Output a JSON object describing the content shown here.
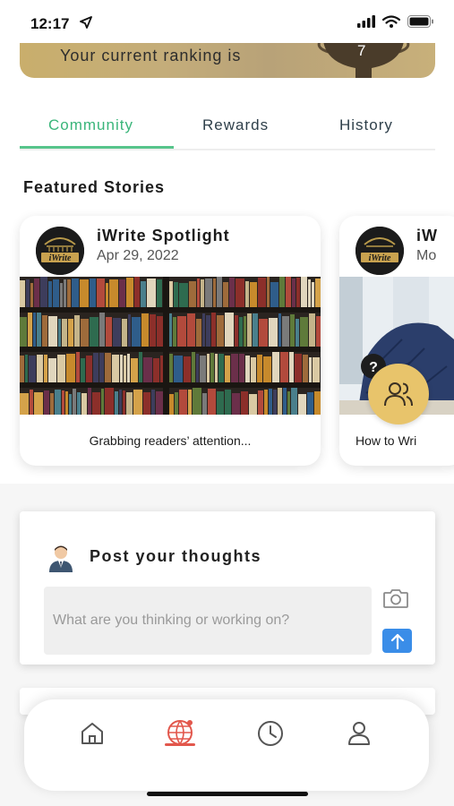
{
  "status_bar": {
    "time": "12:17"
  },
  "ranking": {
    "label": "Your current ranking is",
    "value": "7"
  },
  "tabs": [
    {
      "label": "Community",
      "active": true
    },
    {
      "label": "Rewards",
      "active": false
    },
    {
      "label": "History",
      "active": false
    }
  ],
  "featured": {
    "title": "Featured Stories",
    "stories": [
      {
        "author": "iWrite Spotlight",
        "date": "Apr 29, 2022",
        "caption": "Grabbing readers’ attention..."
      },
      {
        "author": "iW",
        "date": "Mo",
        "caption": "How to Wri"
      }
    ],
    "logo_text": "iWrite"
  },
  "post": {
    "title": "Post your thoughts",
    "placeholder": "What are you thinking or working on?"
  },
  "help_badge": "?",
  "colors": {
    "accent_green": "#3ab57a",
    "send_blue": "#3a8de8",
    "fab_gold": "#e8c46b",
    "nav_active_red": "#e2574c"
  },
  "bottom_nav": [
    {
      "icon": "home-icon",
      "active": false
    },
    {
      "icon": "community-globe-icon",
      "active": true
    },
    {
      "icon": "clock-icon",
      "active": false
    },
    {
      "icon": "profile-icon",
      "active": false
    }
  ]
}
